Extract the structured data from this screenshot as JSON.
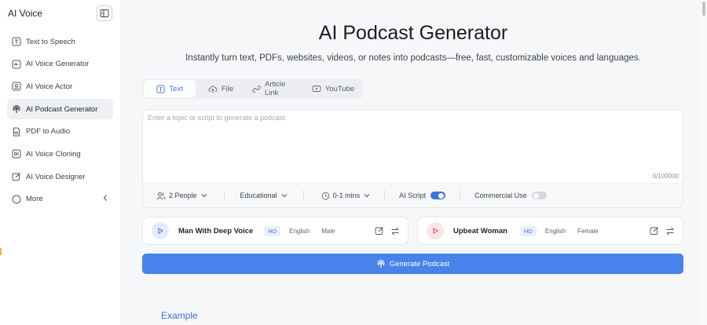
{
  "app": {
    "title": "AI Voice"
  },
  "sidebar": {
    "items": [
      {
        "label": "Text to Speech",
        "icon": "text-to-speech-icon",
        "active": false
      },
      {
        "label": "AI Voice Generator",
        "icon": "voice-generator-icon",
        "active": false
      },
      {
        "label": "AI Voice Actor",
        "icon": "voice-actor-icon",
        "active": false
      },
      {
        "label": "AI Podcast Generator",
        "icon": "podcast-icon",
        "active": true
      },
      {
        "label": "PDF to Audio",
        "icon": "pdf-audio-icon",
        "active": false
      },
      {
        "label": "AI Voice Cloning",
        "icon": "voice-cloning-icon",
        "active": false
      },
      {
        "label": "AI Voice Designer",
        "icon": "voice-designer-icon",
        "active": false
      },
      {
        "label": "More",
        "icon": "more-icon",
        "active": false
      }
    ]
  },
  "main": {
    "title": "AI Podcast Generator",
    "subtitle": "Instantly turn text, PDFs, websites, videos, or notes into podcasts—free, fast, customizable voices and languages.",
    "tabs": [
      {
        "label": "Text",
        "icon": "text-icon",
        "active": true
      },
      {
        "label": "File",
        "icon": "upload-icon",
        "active": false
      },
      {
        "label": "Article Link",
        "icon": "link-icon",
        "active": false
      },
      {
        "label": "YouTube",
        "icon": "youtube-icon",
        "active": false
      }
    ],
    "editor": {
      "placeholder": "Enter a topic or script to generate a podcast.",
      "value": "",
      "counter": "0/100000"
    },
    "options": {
      "people": "2 People",
      "style": "Educational",
      "duration": "0-1 mins",
      "ai_script_label": "AI Script",
      "ai_script_on": true,
      "commercial_label": "Commercial Use",
      "commercial_on": false
    },
    "voices": [
      {
        "name": "Man With Deep Voice",
        "quality": "HD",
        "language": "English",
        "gender": "Male",
        "accent": "#3b74e0"
      },
      {
        "name": "Upbeat Woman",
        "quality": "HD",
        "language": "English",
        "gender": "Female",
        "accent": "#e0445f"
      }
    ],
    "generate_label": "Generate Podcast",
    "example_heading": "Example"
  },
  "colors": {
    "primary": "#4783ea",
    "accent_text": "#3b74e0",
    "sidebar_active": "#eef0f4"
  }
}
